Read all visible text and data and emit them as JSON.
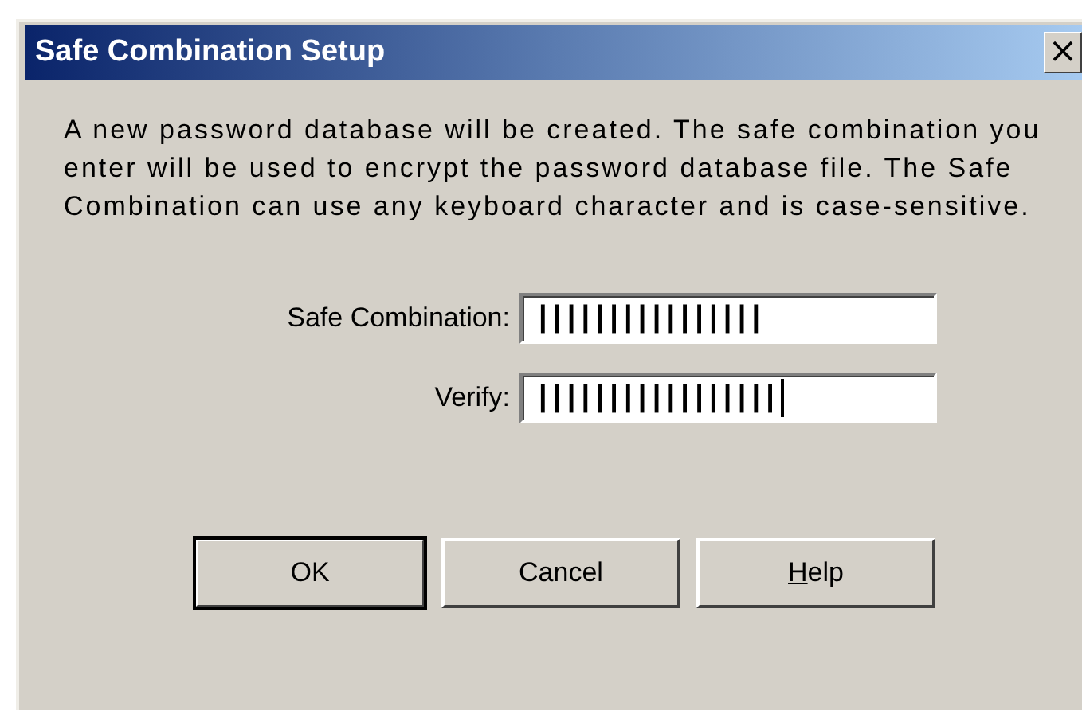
{
  "window": {
    "title": "Safe Combination Setup",
    "close_label": "×"
  },
  "message": "A new password database will be created. The safe combination you enter will be used to encrypt the password database file. The Safe Combination can use any keyboard character and is case-sensitive.",
  "fields": [
    {
      "label": "Safe Combination:",
      "value": "||||||||||||||||",
      "focused": false
    },
    {
      "label": "Verify:",
      "value": "|||||||||||||||||",
      "focused": true
    }
  ],
  "buttons": [
    {
      "label": "OK",
      "default": true
    },
    {
      "label": "Cancel",
      "default": false
    },
    {
      "label": "Help",
      "default": false,
      "mnemonic": true
    }
  ]
}
